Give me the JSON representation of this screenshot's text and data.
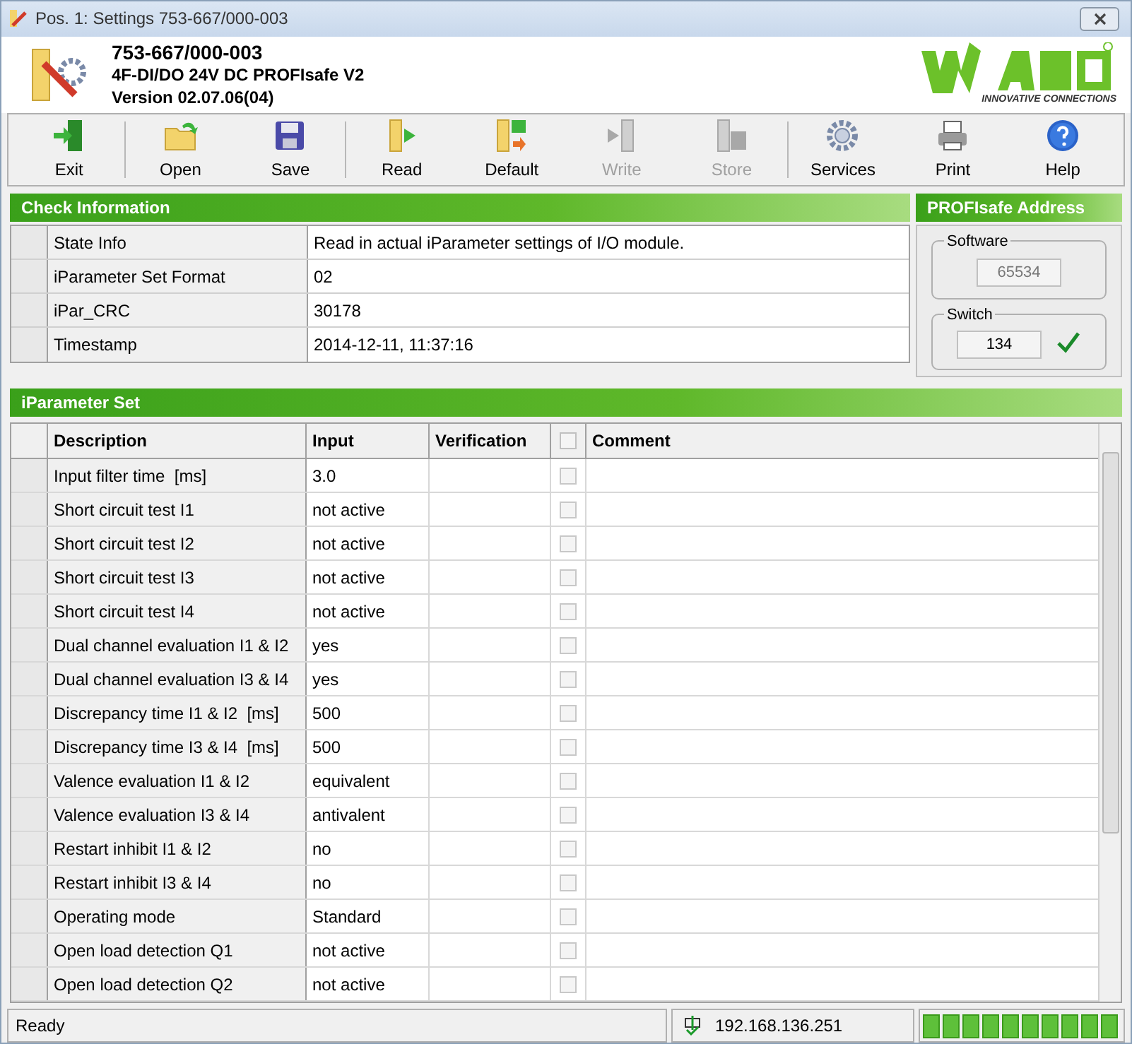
{
  "window": {
    "title": "Pos. 1: Settings 753-667/000-003"
  },
  "header": {
    "article": "753-667/000-003",
    "module": "4F-DI/DO 24V DC PROFIsafe V2",
    "version": "Version 02.07.06(04)",
    "logo_tagline": "INNOVATIVE CONNECTIONS"
  },
  "toolbar": [
    {
      "kind": "exit",
      "label": "Exit",
      "disabled": false
    },
    {
      "kind": "open",
      "label": "Open",
      "disabled": false
    },
    {
      "kind": "save",
      "label": "Save",
      "disabled": false
    },
    {
      "kind": "read",
      "label": "Read",
      "disabled": false
    },
    {
      "kind": "default",
      "label": "Default",
      "disabled": false
    },
    {
      "kind": "write",
      "label": "Write",
      "disabled": true
    },
    {
      "kind": "store",
      "label": "Store",
      "disabled": true
    },
    {
      "kind": "services",
      "label": "Services",
      "disabled": false
    },
    {
      "kind": "print",
      "label": "Print",
      "disabled": false
    },
    {
      "kind": "help",
      "label": "Help",
      "disabled": false
    }
  ],
  "check_information": {
    "title": "Check Information",
    "rows": [
      {
        "label": "State Info",
        "value": "Read in actual iParameter settings of I/O module."
      },
      {
        "label": "iParameter Set Format",
        "value": "02"
      },
      {
        "label": "iPar_CRC",
        "value": "30178"
      },
      {
        "label": "Timestamp",
        "value": "2014-12-11, 11:37:16"
      }
    ]
  },
  "profisafe_address": {
    "title": "PROFIsafe Address",
    "software_label": "Software",
    "software_value": "65534",
    "switch_label": "Switch",
    "switch_value": "134",
    "switch_ok": true
  },
  "iparameter_set": {
    "title": "iParameter Set",
    "columns": [
      "Description",
      "Input",
      "Verification",
      "Comment"
    ],
    "header_checked": false,
    "rows": [
      {
        "description": "Input filter time  [ms]",
        "input": "3.0",
        "checked": false
      },
      {
        "description": "Short circuit test I1",
        "input": "not active",
        "checked": false
      },
      {
        "description": "Short circuit test I2",
        "input": "not active",
        "checked": false
      },
      {
        "description": "Short circuit test I3",
        "input": "not active",
        "checked": false
      },
      {
        "description": "Short circuit test I4",
        "input": "not active",
        "checked": false
      },
      {
        "description": "Dual channel evaluation I1 & I2",
        "input": "yes",
        "checked": false
      },
      {
        "description": "Dual channel evaluation I3 & I4",
        "input": "yes",
        "checked": false
      },
      {
        "description": "Discrepancy time I1 & I2  [ms]",
        "input": "500",
        "checked": false
      },
      {
        "description": "Discrepancy time I3 & I4  [ms]",
        "input": "500",
        "checked": false
      },
      {
        "description": "Valence evaluation I1 & I2",
        "input": "equivalent",
        "checked": false
      },
      {
        "description": "Valence evaluation I3 & I4",
        "input": "antivalent",
        "checked": false
      },
      {
        "description": "Restart inhibit I1 & I2",
        "input": "no",
        "checked": false
      },
      {
        "description": "Restart inhibit I3 & I4",
        "input": "no",
        "checked": false
      },
      {
        "description": "Operating mode",
        "input": "Standard",
        "checked": false
      },
      {
        "description": "Open load detection Q1",
        "input": "not active",
        "checked": false
      },
      {
        "description": "Open load detection Q2",
        "input": "not active",
        "checked": false
      }
    ]
  },
  "status_bar": {
    "status": "Ready",
    "ip": "192.168.136.251",
    "level": 1
  }
}
